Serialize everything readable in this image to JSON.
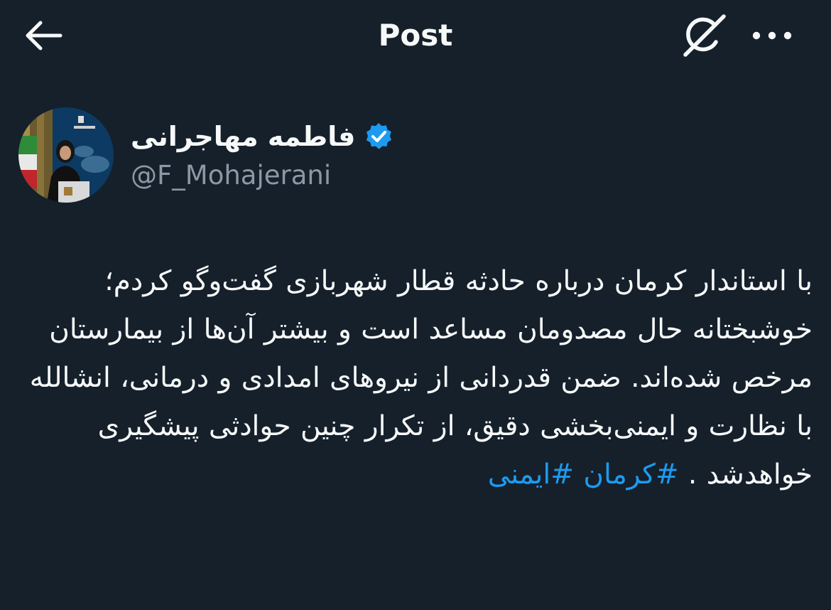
{
  "header": {
    "title": "Post",
    "back_icon": "arrow-left-icon",
    "grok_icon": "grok-icon",
    "more_icon": "more-horizontal-icon"
  },
  "author": {
    "display_name": "فاطمه مهاجرانی",
    "handle": "@F_Mohajerani",
    "verified": true,
    "verified_color": "#1d9bf0"
  },
  "tweet": {
    "text_main": "با استاندار کرمان درباره حادثه قطار شهربازی گفت‌وگو کردم؛ خوشبختانه حال مصدومان مساعد است و بیشتر آن‌ها از بیمارستان مرخص شده‌اند. ضمن قدردانی از نیروهای امدادی و درمانی، انشالله با نظارت و ایمنی‌بخشی دقیق، از تکرار چنین حوادثی پیشگیری خواهدشد .",
    "hashtag_1": "#کرمان",
    "hashtag_2": "#ایمنی"
  },
  "colors": {
    "background": "#15202b",
    "text": "#f7f9f9",
    "secondary_text": "#8b98a5",
    "link": "#1d9bf0"
  }
}
